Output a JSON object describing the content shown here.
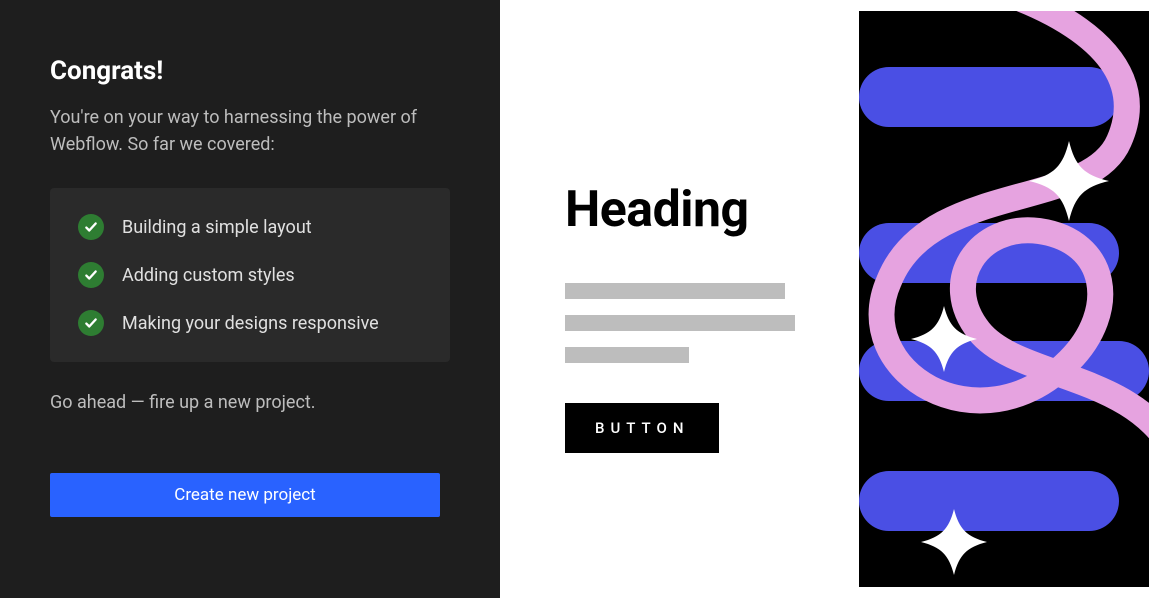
{
  "panel": {
    "title": "Congrats!",
    "subtitle": "You're on your way to harnessing the power of Webflow. So far we covered:",
    "checklist": [
      "Building a simple layout",
      "Adding custom styles",
      "Making your designs responsive"
    ],
    "footer_text": "Go ahead — fire up a new project.",
    "cta_label": "Create new project"
  },
  "preview": {
    "heading": "Heading",
    "button_label": "BUTTON"
  },
  "colors": {
    "accent_blue": "#2962ff",
    "stripe_blue": "#4a4fe4",
    "ribbon_pink": "#e6a3e0",
    "check_green": "#2e7d32"
  }
}
